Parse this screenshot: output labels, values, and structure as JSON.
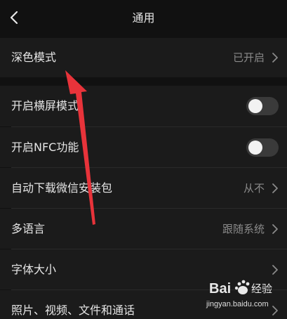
{
  "header": {
    "title": "通用",
    "back_icon": "chevron-left-icon"
  },
  "rows": [
    {
      "label": "深色模式",
      "value": "已开启",
      "control": "chevron"
    },
    {
      "label": "开启横屏模式",
      "control": "toggle",
      "toggle_on": false
    },
    {
      "label": "开启NFC功能",
      "control": "toggle",
      "toggle_on": false
    },
    {
      "label": "自动下载微信安装包",
      "value": "从不",
      "control": "chevron"
    },
    {
      "label": "多语言",
      "value": "跟随系统",
      "control": "chevron"
    },
    {
      "label": "字体大小",
      "control": "chevron"
    },
    {
      "label": "照片、视频、文件和通话",
      "control": "chevron"
    }
  ],
  "annotation": {
    "arrow_color": "#e8333a"
  },
  "watermark": {
    "logo_text": "Bai",
    "logo_suffix": "经验",
    "url": "jingyan.baidu.com"
  },
  "colors": {
    "background": "#111111",
    "row_background": "#1b1b1b",
    "text_primary": "#e6e6e6",
    "text_secondary": "#8a8a8a",
    "toggle_off": "#3a3a3a"
  }
}
